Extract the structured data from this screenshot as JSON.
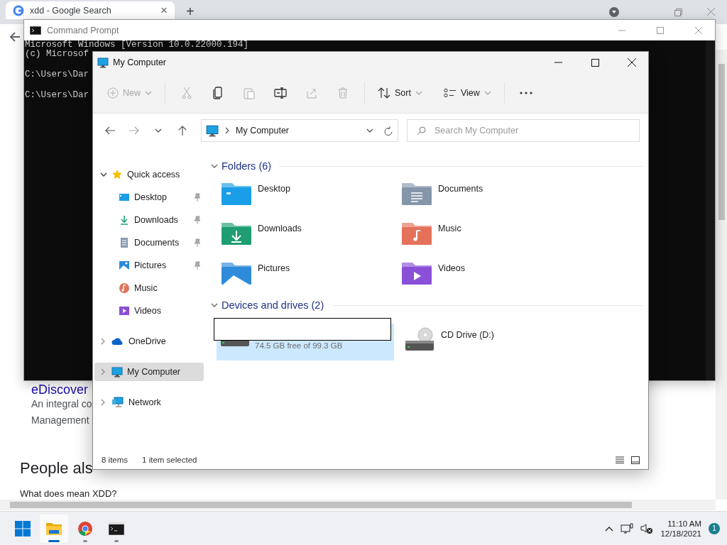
{
  "browser": {
    "tab": {
      "title": "xdd - Google Search",
      "close": "×"
    },
    "new_tab": "+",
    "page": {
      "result_title": "eDiscover",
      "snippet_lines": [
        "An integral co",
        "Management"
      ],
      "section": "People als",
      "question": "What does mean XDD?"
    }
  },
  "console": {
    "title": "Command Prompt",
    "lines": [
      {
        "kind": "text",
        "text": "Microsoft Windows [Version 10.0.22000.194]"
      },
      {
        "kind": "text",
        "text": "(c) Microsof"
      },
      {
        "kind": "blank"
      },
      {
        "kind": "text",
        "text": "C:\\Users\\Dar"
      },
      {
        "kind": "blank"
      },
      {
        "kind": "text",
        "text": "C:\\Users\\Dar"
      }
    ]
  },
  "explorer": {
    "title": "My Computer",
    "toolbar": [
      {
        "kind": "new",
        "label": "New",
        "disabled": true
      },
      {
        "kind": "cut",
        "disabled": true
      },
      {
        "kind": "copy",
        "disabled": false
      },
      {
        "kind": "paste",
        "disabled": true
      },
      {
        "kind": "rename",
        "disabled": false
      },
      {
        "kind": "share",
        "disabled": true
      },
      {
        "kind": "delete",
        "disabled": true
      },
      {
        "kind": "sort",
        "label": "Sort",
        "disabled": false
      },
      {
        "kind": "view",
        "label": "View",
        "disabled": false
      },
      {
        "kind": "more",
        "disabled": false
      }
    ],
    "address": {
      "location": "My Computer"
    },
    "search": {
      "placeholder": "Search My Computer"
    },
    "nav": [
      {
        "label": "Quick access",
        "kind": "star",
        "expanded": true,
        "selected": false,
        "children": [
          {
            "label": "Desktop",
            "kind": "desktop",
            "pinned": true,
            "selected": false
          },
          {
            "label": "Downloads",
            "kind": "downloads",
            "pinned": true,
            "selected": false
          },
          {
            "label": "Documents",
            "kind": "documents",
            "pinned": true,
            "selected": false
          },
          {
            "label": "Pictures",
            "kind": "pictures",
            "pinned": true,
            "selected": false
          },
          {
            "label": "Music",
            "kind": "music",
            "pinned": false,
            "selected": false
          },
          {
            "label": "Videos",
            "kind": "videos",
            "pinned": false,
            "selected": false
          }
        ]
      },
      {
        "label": "OneDrive",
        "kind": "cloud",
        "expanded": false,
        "selected": false
      },
      {
        "label": "My Computer",
        "kind": "computer",
        "expanded": false,
        "selected": true
      },
      {
        "label": "Network",
        "kind": "network",
        "expanded": false,
        "selected": false
      }
    ],
    "folders": {
      "title": "Folders (6)",
      "expanded": true,
      "items": [
        {
          "label": "Desktop",
          "kind": "desktop"
        },
        {
          "label": "Documents",
          "kind": "documents"
        },
        {
          "label": "Downloads",
          "kind": "downloads"
        },
        {
          "label": "Music",
          "kind": "music"
        },
        {
          "label": "Pictures",
          "kind": "pictures"
        },
        {
          "label": "Videos",
          "kind": "videos"
        }
      ]
    },
    "devices": {
      "title": "Devices and drives (2)",
      "expanded": true,
      "items": [
        {
          "kind": "disk",
          "free": "74.5 GB free of 99.3 GB",
          "selected": true,
          "redacted": true
        },
        {
          "kind": "cd",
          "label": "CD Drive (D:)",
          "selected": false,
          "redacted": false
        }
      ]
    },
    "status": {
      "count": "8 items",
      "selection": "1 item selected"
    }
  },
  "taskbar": {
    "apps": [
      {
        "kind": "start",
        "active": false,
        "running": false
      },
      {
        "kind": "explorer",
        "active": true,
        "running": true
      },
      {
        "kind": "chrome",
        "active": false,
        "running": true
      },
      {
        "kind": "terminal",
        "active": false,
        "running": true
      }
    ],
    "time": "11:10 AM",
    "date": "12/18/2021",
    "badge": "1"
  }
}
